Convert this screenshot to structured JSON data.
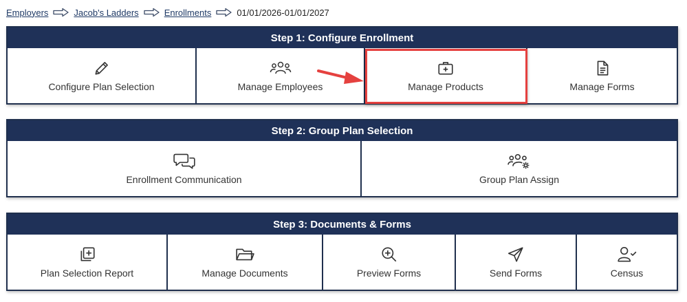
{
  "breadcrumb": {
    "items": [
      "Employers",
      "Jacob's Ladders",
      "Enrollments"
    ],
    "current": "01/01/2026-01/01/2027"
  },
  "step1": {
    "title": "Step 1: Configure Enrollment",
    "tiles": [
      {
        "label": "Configure Plan Selection",
        "icon": "pencil-icon"
      },
      {
        "label": "Manage Employees",
        "icon": "users-icon"
      },
      {
        "label": "Manage Products",
        "icon": "medical-kit-icon"
      },
      {
        "label": "Manage Forms",
        "icon": "document-icon"
      }
    ]
  },
  "step2": {
    "title": "Step 2: Group Plan Selection",
    "tiles": [
      {
        "label": "Enrollment Communication",
        "icon": "chat-bubbles-icon"
      },
      {
        "label": "Group Plan Assign",
        "icon": "users-gear-icon"
      }
    ]
  },
  "step3": {
    "title": "Step 3: Documents & Forms",
    "tiles": [
      {
        "label": "Plan Selection Report",
        "icon": "copy-plus-icon"
      },
      {
        "label": "Manage Documents",
        "icon": "folder-icon"
      },
      {
        "label": "Preview Forms",
        "icon": "zoom-in-icon"
      },
      {
        "label": "Send Forms",
        "icon": "paper-plane-icon"
      },
      {
        "label": "Census",
        "icon": "user-check-icon"
      }
    ]
  },
  "colors": {
    "header_bg": "#1f3158",
    "border": "#1f2f4d",
    "highlight": "#e5413f",
    "link": "#1f3a66"
  }
}
